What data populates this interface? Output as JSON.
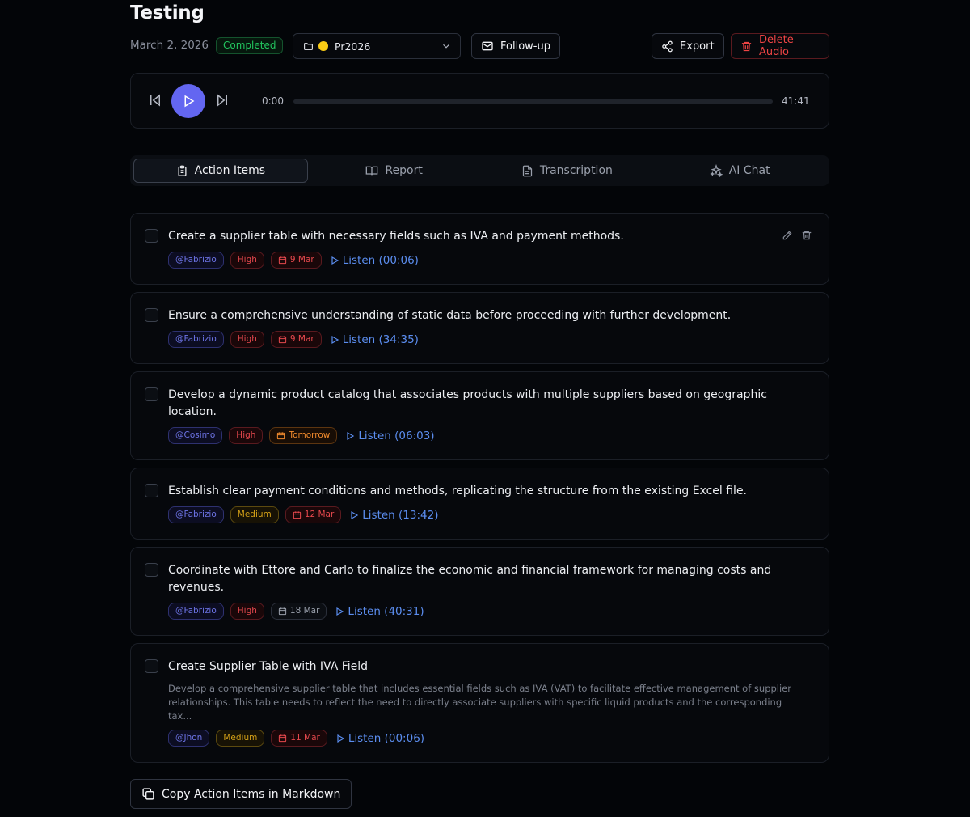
{
  "header": {
    "title": "Testing",
    "date": "March 2, 2026",
    "status": "Completed",
    "folder": "Pr2026",
    "follow_up_label": "Follow-up",
    "export_label": "Export",
    "delete_label": "Delete Audio"
  },
  "player": {
    "current_time": "0:00",
    "total_time": "41:41",
    "progress": 0
  },
  "tabs": [
    {
      "label": "Action Items",
      "icon": "clipboard-icon",
      "active": true
    },
    {
      "label": "Report",
      "icon": "book-icon",
      "active": false
    },
    {
      "label": "Transcription",
      "icon": "document-icon",
      "active": false
    },
    {
      "label": "AI Chat",
      "icon": "sparkles-icon",
      "active": false
    }
  ],
  "action_items": [
    {
      "text": "Create a supplier table with necessary fields such as IVA and payment methods.",
      "assignee": "@Fabrizio",
      "priority": "High",
      "due": "9 Mar",
      "listen": "Listen (00:06)"
    },
    {
      "text": "Ensure a comprehensive understanding of static data before proceeding with further development.",
      "assignee": "@Fabrizio",
      "priority": "High",
      "due": "9 Mar",
      "listen": "Listen (34:35)"
    },
    {
      "text": "Develop a dynamic product catalog that associates products with multiple suppliers based on geographic location.",
      "assignee": "@Cosimo",
      "priority": "High",
      "due": "Tomorrow",
      "listen": "Listen (06:03)"
    },
    {
      "text": "Establish clear payment conditions and methods, replicating the structure from the existing Excel file.",
      "assignee": "@Fabrizio",
      "priority": "Medium",
      "due": "12 Mar",
      "listen": "Listen (13:42)"
    },
    {
      "text": "Coordinate with Ettore and Carlo to finalize the economic and financial framework for managing costs and revenues.",
      "assignee": "@Fabrizio",
      "priority": "High",
      "due": "18 Mar",
      "listen": "Listen (40:31)"
    },
    {
      "text": "Create Supplier Table with IVA Field",
      "description": "Develop a comprehensive supplier table that includes essential fields such as IVA (VAT) to facilitate effective management of supplier relationships. This table needs to reflect the need to directly associate suppliers with specific liquid products and the corresponding tax...",
      "assignee": "@Jhon",
      "priority": "Medium",
      "due": "11 Mar",
      "listen": "Listen (00:06)"
    }
  ],
  "footer": {
    "copy_label": "Copy Action Items in Markdown"
  }
}
